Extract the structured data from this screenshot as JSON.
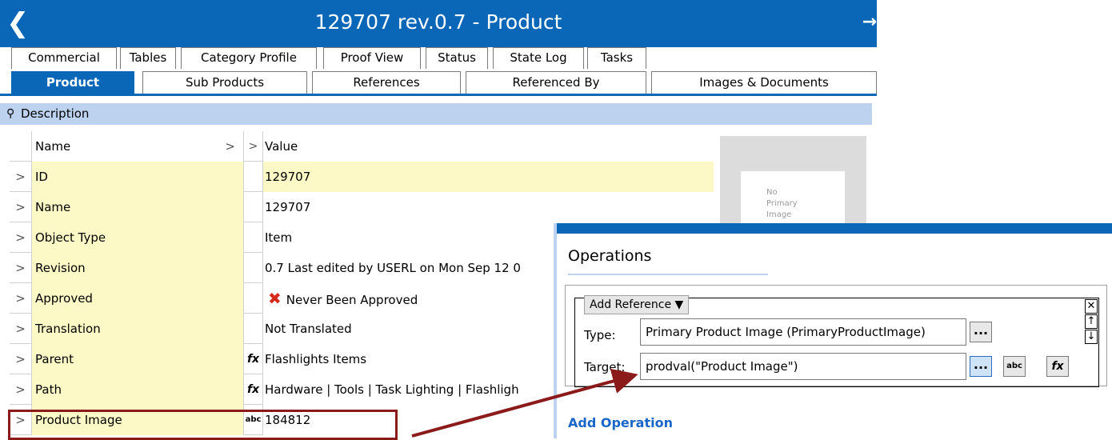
{
  "window": {
    "title": "129707 rev.0.7 - Product",
    "back_icon": "chevron-left-icon",
    "pin_icon": "arrow-pin-icon"
  },
  "tabs_row1": [
    "Commercial",
    "Tables",
    "Category Profile",
    "Proof View",
    "Status",
    "State Log",
    "Tasks"
  ],
  "tabs_row2": {
    "active": "Product",
    "items": [
      "Product",
      "Sub Products",
      "References",
      "Referenced By",
      "Images & Documents"
    ]
  },
  "section": {
    "title": "Description",
    "icon": "pin-icon"
  },
  "grid": {
    "header": {
      "name": "Name",
      "name_arrow": ">",
      "mid": ">",
      "value": "Value"
    },
    "rows": [
      {
        "expander": ">",
        "name": "ID",
        "marker": "",
        "value": "129707"
      },
      {
        "expander": ">",
        "name": "Name",
        "marker": "",
        "value": "129707"
      },
      {
        "expander": ">",
        "name": "Object Type",
        "marker": "",
        "value": "Item"
      },
      {
        "expander": ">",
        "name": "Revision",
        "marker": "",
        "value": "0.7 Last edited by USERL on Mon Sep 12 0"
      },
      {
        "expander": ">",
        "name": "Approved",
        "marker": "",
        "value": "Never Been Approved"
      },
      {
        "expander": ">",
        "name": "Translation",
        "marker": "",
        "value": "Not Translated"
      },
      {
        "expander": ">",
        "name": "Parent",
        "marker": "fx",
        "value": "Flashlights Items"
      },
      {
        "expander": ">",
        "name": "Path",
        "marker": "fx",
        "value": "Hardware | Tools | Task Lighting | Flashligh"
      },
      {
        "expander": ">",
        "name": "Product Image",
        "marker": "abc",
        "value": "184812"
      }
    ]
  },
  "image_placeholder": {
    "line1": "No",
    "line2": "Primary",
    "line3": "Image"
  },
  "operations": {
    "title": "Operations",
    "dropdown_label": "Add Reference",
    "type_label": "Type:",
    "type_value": "Primary Product Image (PrimaryProductImage)",
    "target_label": "Target:",
    "target_value": "prodval(\"Product Image\")",
    "browse_label": "...",
    "abc_label": "abc",
    "fx_label": "fx",
    "add_operation": "Add Operation",
    "close_icon": "close-icon",
    "up_icon": "arrow-up-icon",
    "down_icon": "arrow-down-icon"
  },
  "colors": {
    "accent": "#0a66b7",
    "section": "#bcd2ee",
    "field_bg": "#fdf9c7",
    "highlight": "#8b1a1a",
    "link": "#1a66c8",
    "error": "#d32b1e"
  }
}
